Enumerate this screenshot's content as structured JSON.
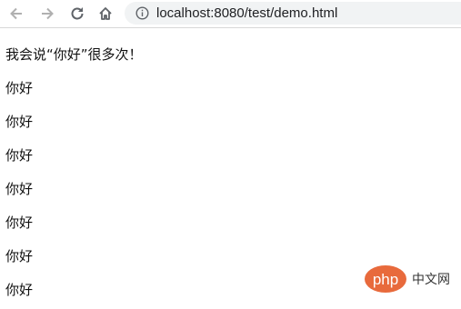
{
  "browser": {
    "url": "localhost:8080/test/demo.html",
    "icons": [
      "back-arrow-icon",
      "forward-arrow-icon",
      "reload-icon",
      "home-icon",
      "info-icon"
    ]
  },
  "page": {
    "heading": "我会说“你好”很多次！",
    "lines": [
      "你好",
      "你好",
      "你好",
      "你好",
      "你好",
      "你好",
      "你好"
    ]
  },
  "watermark": {
    "logo_text": "php",
    "label": "中文网"
  }
}
